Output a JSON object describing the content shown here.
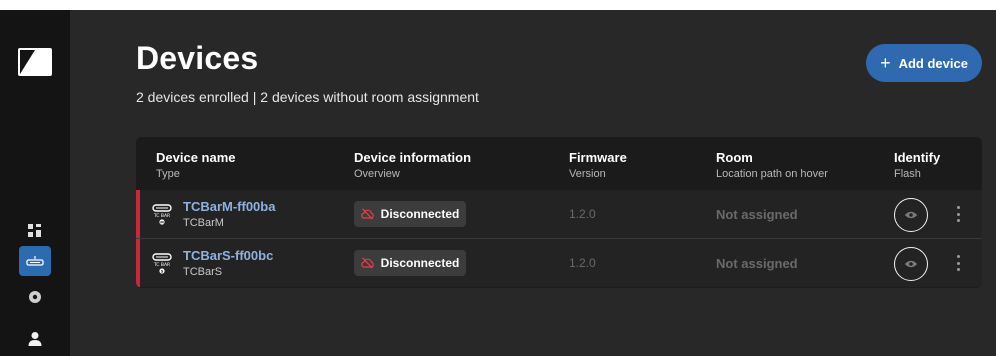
{
  "header": {
    "title": "Devices",
    "subtitle": "2 devices enrolled | 2 devices without room assignment",
    "add_button_label": "Add device",
    "add_button_icon": "plus-icon"
  },
  "sidebar": {
    "items": [
      {
        "name": "dashboard",
        "icon": "grid-icon",
        "active": false
      },
      {
        "name": "devices",
        "icon": "device-bar-icon",
        "active": true
      },
      {
        "name": "locations",
        "icon": "location-pin-icon",
        "active": false
      },
      {
        "name": "users",
        "icon": "user-icon",
        "active": false
      }
    ]
  },
  "table": {
    "columns": [
      {
        "title": "Device name",
        "subtitle": "Type"
      },
      {
        "title": "Device information",
        "subtitle": "Overview"
      },
      {
        "title": "Firmware",
        "subtitle": "Version"
      },
      {
        "title": "Room",
        "subtitle": "Location path on hover"
      },
      {
        "title": "Identify",
        "subtitle": "Flash"
      }
    ],
    "rows": [
      {
        "name": "TCBarM-ff00ba",
        "type": "TCBarM",
        "icon_text": "TC BAR",
        "icon_badge": "M",
        "status": "Disconnected",
        "firmware": "1.2.0",
        "room": "Not assigned"
      },
      {
        "name": "TCBarS-ff00bc",
        "type": "TCBarS",
        "icon_text": "TC BAR",
        "icon_badge": "S",
        "status": "Disconnected",
        "firmware": "1.2.0",
        "room": "Not assigned"
      }
    ]
  },
  "colors": {
    "accent": "#2f6ab0",
    "status_error": "#c8283c",
    "link": "#8fb1e0"
  }
}
